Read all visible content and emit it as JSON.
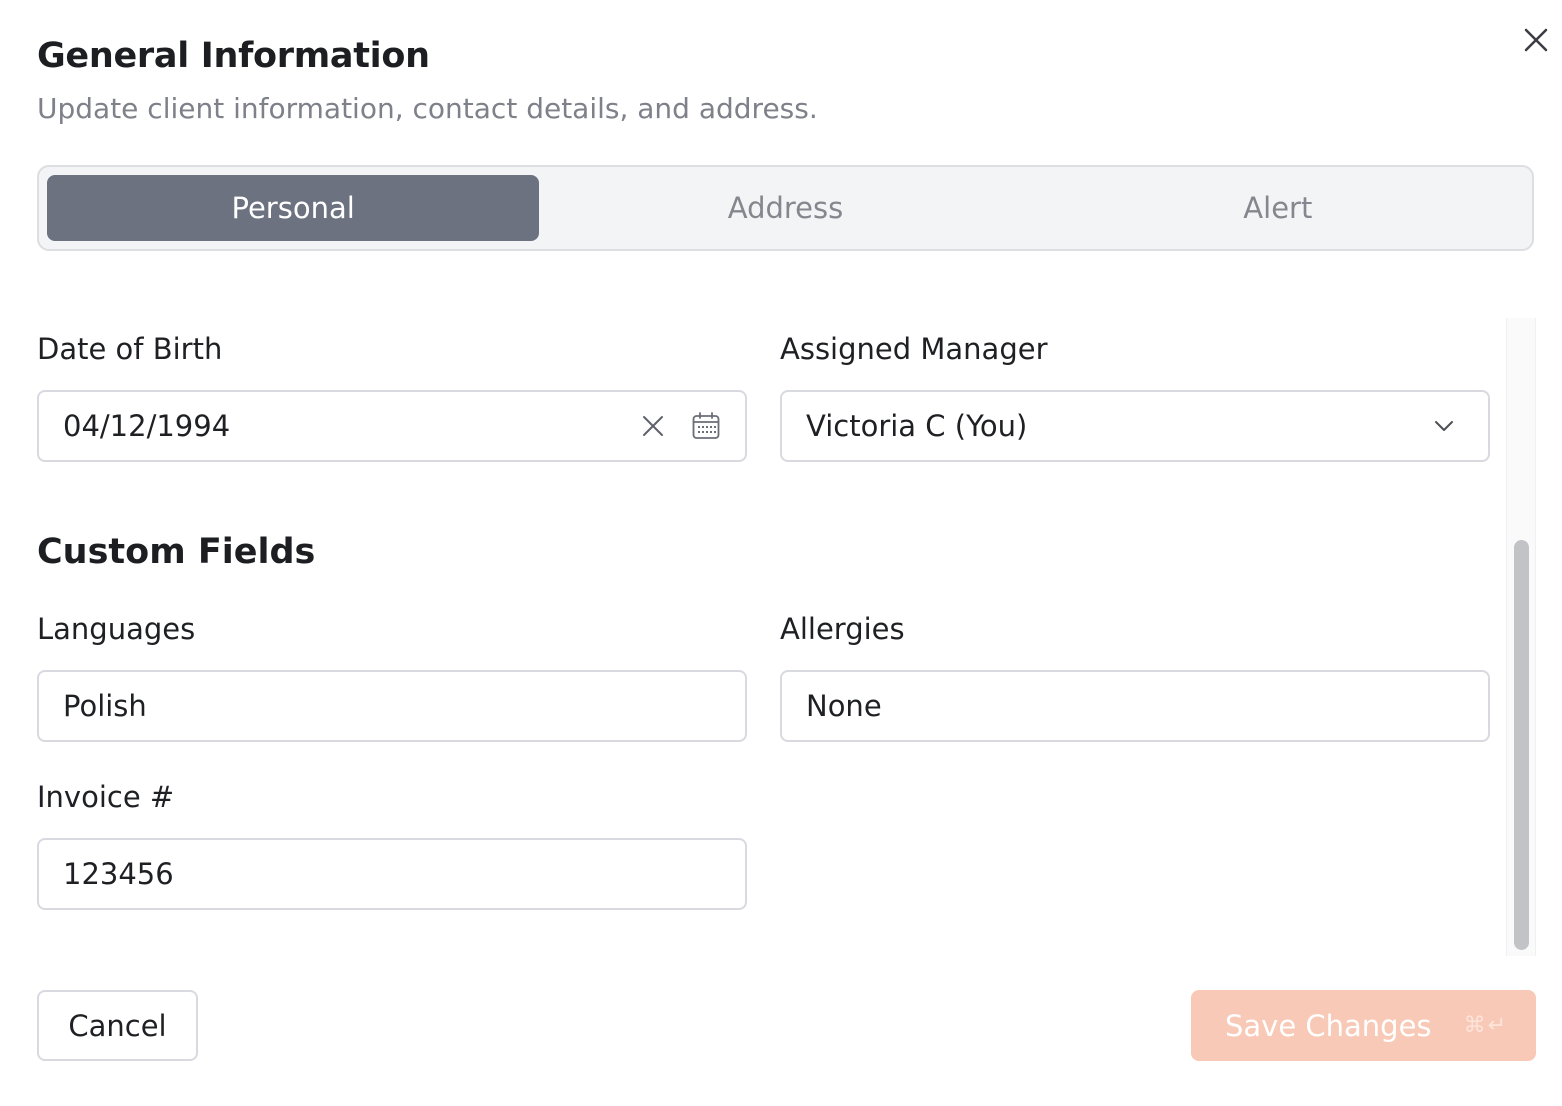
{
  "dialog": {
    "title": "General Information",
    "subtitle": "Update client information, contact details, and address."
  },
  "tabs": [
    {
      "label": "Personal",
      "active": true
    },
    {
      "label": "Address",
      "active": false
    },
    {
      "label": "Alert",
      "active": false
    }
  ],
  "fields": {
    "date_of_birth": {
      "label": "Date of Birth",
      "value": "04/12/1994"
    },
    "assigned_manager": {
      "label": "Assigned Manager",
      "value": "Victoria C (You)"
    },
    "languages": {
      "label": "Languages",
      "value": "Polish"
    },
    "allergies": {
      "label": "Allergies",
      "value": "None"
    },
    "invoice": {
      "label": "Invoice #",
      "value": "123456"
    }
  },
  "custom_fields_heading": "Custom Fields",
  "footer": {
    "cancel_label": "Cancel",
    "save_label": "Save Changes",
    "save_shortcut": "⌘↵"
  },
  "colors": {
    "active_tab": "#6c7280",
    "save_button": "#f8c9b6"
  },
  "icons": [
    "close-icon",
    "clear-icon",
    "calendar-icon",
    "chevron-down-icon"
  ]
}
